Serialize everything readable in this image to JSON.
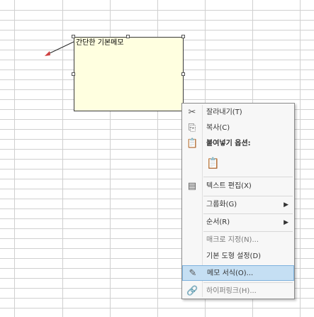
{
  "comment": {
    "text": "간단한 기본메모"
  },
  "mini_toolbar": {
    "icons": [
      "cut-icon",
      "copy-icon",
      "paste-icon",
      "format-cells-icon",
      "format-comment-icon",
      "hyperlink-icon"
    ]
  },
  "menu": {
    "items": [
      {
        "label": "잘라내기(T)",
        "icon": "scissors-icon"
      },
      {
        "label": "복사(C)",
        "icon": "copy-icon"
      },
      {
        "label": "붙여넣기 옵션:",
        "icon": "paste-icon"
      },
      {
        "label": "",
        "icon": "paste-option-icon"
      },
      {
        "label": "텍스트 편집(X)",
        "icon": "edit-text-icon"
      },
      {
        "label": "그룹화(G)",
        "submenu": true
      },
      {
        "label": "순서(R)",
        "submenu": true
      },
      {
        "label": "매크로 지정(N)..."
      },
      {
        "label": "기본 도형 설정(D)"
      },
      {
        "label": "메모 서식(O)...",
        "icon": "format-comment-icon",
        "highlighted": true
      },
      {
        "label": "하이퍼링크(H)...",
        "icon": "hyperlink-icon"
      }
    ]
  },
  "colors": {
    "comment_bg": "#ffffe0",
    "highlight": "#c5dff3",
    "arrow": "#2a2a2a",
    "arrow_head": "#d04040"
  }
}
